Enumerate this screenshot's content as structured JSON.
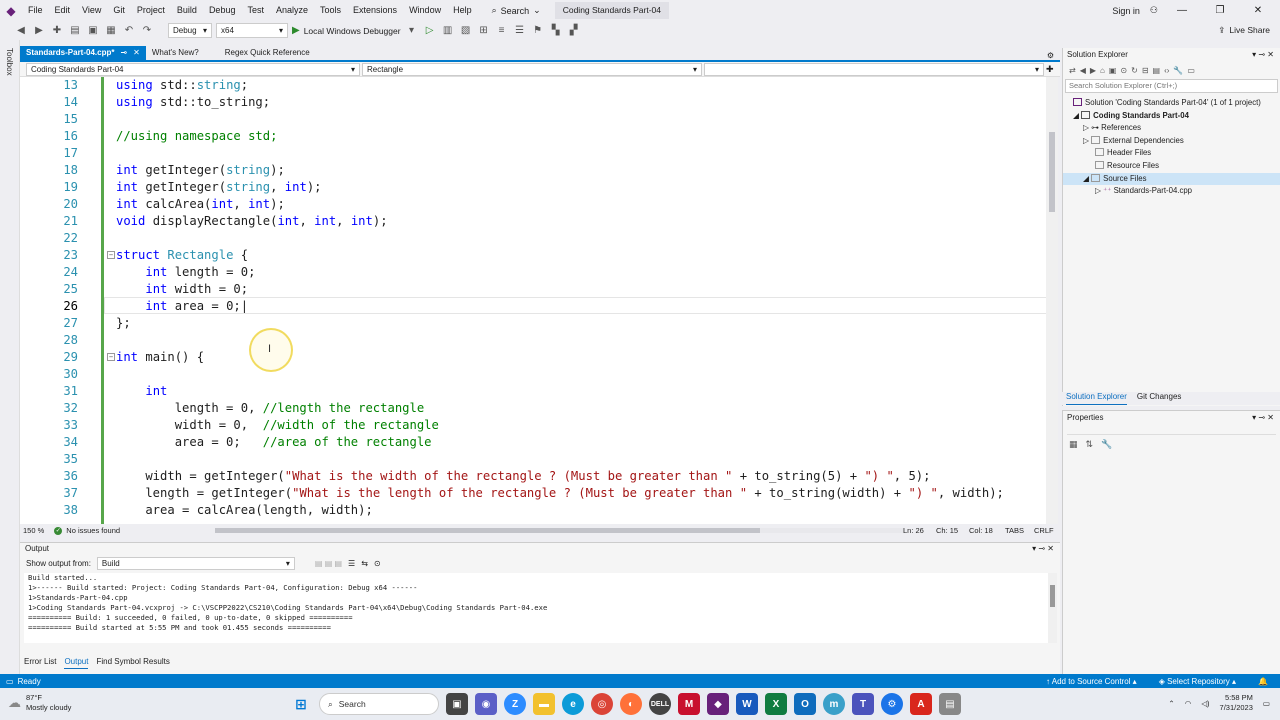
{
  "menubar": {
    "items": [
      "File",
      "Edit",
      "View",
      "Git",
      "Project",
      "Build",
      "Debug",
      "Test",
      "Analyze",
      "Tools",
      "Extensions",
      "Window",
      "Help"
    ],
    "search": "Search",
    "solution_title": "Coding Standards Part-04",
    "signin": "Sign in",
    "liveshare": "Live Share"
  },
  "toolbar": {
    "config": "Debug",
    "platform": "x64",
    "run": "Local Windows Debugger"
  },
  "toolbox_label": "Toolbox",
  "tabs": [
    {
      "label": "Standards-Part-04.cpp*"
    },
    {
      "label": "What's New?"
    },
    {
      "label": "Regex Quick Reference"
    }
  ],
  "navbar": {
    "project": "Coding Standards Part-04",
    "scope": "Rectangle"
  },
  "editor": {
    "current_line": "26"
  },
  "edstatus": {
    "zoom": "150 %",
    "issues": "No issues found",
    "ln": "Ln: 26",
    "ch": "Ch: 15",
    "col": "Col: 18",
    "tabs": "TABS",
    "eol": "CRLF"
  },
  "output": {
    "title": "Output",
    "from_label": "Show output from:",
    "from_value": "Build",
    "lines": [
      "Build started...",
      "1>------ Build started: Project: Coding Standards Part-04, Configuration: Debug x64 ------",
      "1>Standards-Part-04.cpp",
      "1>Coding Standards Part-04.vcxproj -> C:\\VSCPP2022\\CS210\\Coding Standards Part-04\\x64\\Debug\\Coding Standards Part-04.exe",
      "========== Build: 1 succeeded, 0 failed, 0 up-to-date, 0 skipped ==========",
      "========== Build started at 5:55 PM and took 01.455 seconds =========="
    ],
    "bottom_tabs": [
      "Error List",
      "Output",
      "Find Symbol Results"
    ]
  },
  "solution_explorer": {
    "title": "Solution Explorer",
    "search_placeholder": "Search Solution Explorer (Ctrl+;)",
    "tree": [
      "Solution 'Coding Standards Part-04' (1 of 1 project)",
      "Coding Standards Part-04",
      "References",
      "External Dependencies",
      "Header Files",
      "Resource Files",
      "Source Files",
      "Standards-Part-04.cpp"
    ],
    "tabs": [
      "Solution Explorer",
      "Git Changes"
    ]
  },
  "properties": {
    "title": "Properties"
  },
  "statusbar": {
    "ready": "Ready",
    "source_control": "Add to Source Control",
    "repo": "Select Repository"
  },
  "taskbar": {
    "temp": "87°F",
    "weather": "Mostly cloudy",
    "search": "Search",
    "time": "5:58 PM",
    "date": "7/31/2023"
  },
  "colors": {
    "accent": "#007acc",
    "keyword": "#0000ff",
    "type": "#2b91af",
    "string": "#a31515",
    "comment": "#008000"
  }
}
